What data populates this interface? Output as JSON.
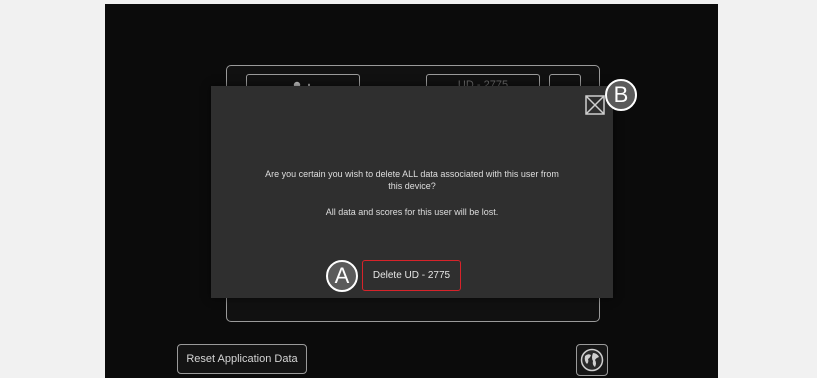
{
  "panel": {
    "user_id_partial": "UD - 2775"
  },
  "footer": {
    "reset_label": "Reset Application Data"
  },
  "modal": {
    "message": "Are you certain you wish to delete ALL data associated with this user from\nthis device?",
    "note": "All data and scores for this user will be lost.",
    "delete_label": "Delete UD - 2775"
  },
  "callouts": {
    "a": "A",
    "b": "B"
  },
  "colors": {
    "background": "#f1f1f1",
    "app": "#0b0b0b",
    "modal": "#2f2f2f",
    "danger": "#d8232a",
    "callout": "#5b5b5b"
  },
  "icons": {
    "add_user": "add-user-icon",
    "close": "close-icon",
    "globe": "globe-icon"
  }
}
